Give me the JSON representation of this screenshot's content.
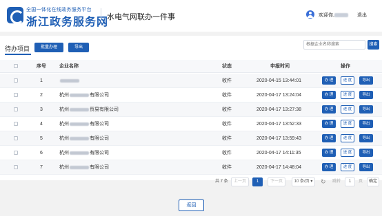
{
  "header": {
    "logo_small": "全国一体化在线政务服务平台",
    "logo_big": "浙江政务服务网",
    "title": "水电气网联办一件事",
    "welcome": "欢迎你,",
    "logout": "退出"
  },
  "panel": {
    "title": "待办项目",
    "batch_label": "批量办理",
    "export_label": "导出",
    "search_placeholder": "根据企业名称搜索",
    "search_label": "搜索"
  },
  "table": {
    "headers": {
      "no": "序号",
      "name": "企业名称",
      "status": "状态",
      "time": "申报时间",
      "ops": "操作"
    },
    "op_labels": {
      "do": "办 理",
      "progress": "进 度",
      "export": "导出"
    },
    "rows": [
      {
        "no": "1",
        "name_prefix": "",
        "name_suffix": "",
        "status": "收件",
        "time": "2020-04-15 13:44:01"
      },
      {
        "no": "2",
        "name_prefix": "杭州",
        "name_suffix": "有限公司",
        "status": "收件",
        "time": "2020-04-17 13:24:04"
      },
      {
        "no": "3",
        "name_prefix": "杭州",
        "name_suffix": "贸易有限公司",
        "status": "收件",
        "time": "2020-04-17 13:27:38"
      },
      {
        "no": "4",
        "name_prefix": "杭州",
        "name_suffix": "有限公司",
        "status": "收件",
        "time": "2020-04-17 13:52:33"
      },
      {
        "no": "5",
        "name_prefix": "杭州",
        "name_suffix": "有限公司",
        "status": "收件",
        "time": "2020-04-17 13:59:43"
      },
      {
        "no": "6",
        "name_prefix": "杭州",
        "name_suffix": "有限公司",
        "status": "收件",
        "time": "2020-04-17 14:11:35"
      },
      {
        "no": "7",
        "name_prefix": "杭州",
        "name_suffix": "有限公司",
        "status": "收件",
        "time": "2020-04-17 14:48:04"
      }
    ]
  },
  "pagination": {
    "total": "共 7 条",
    "prev": "上一页",
    "current": "1",
    "next": "下一页",
    "page_size": "10 条/页",
    "goto_label": "跳转",
    "goto_value": "1",
    "page_unit": "页",
    "confirm": "确定"
  },
  "back_label": "返回",
  "colors": {
    "primary": "#1f5fb5"
  }
}
